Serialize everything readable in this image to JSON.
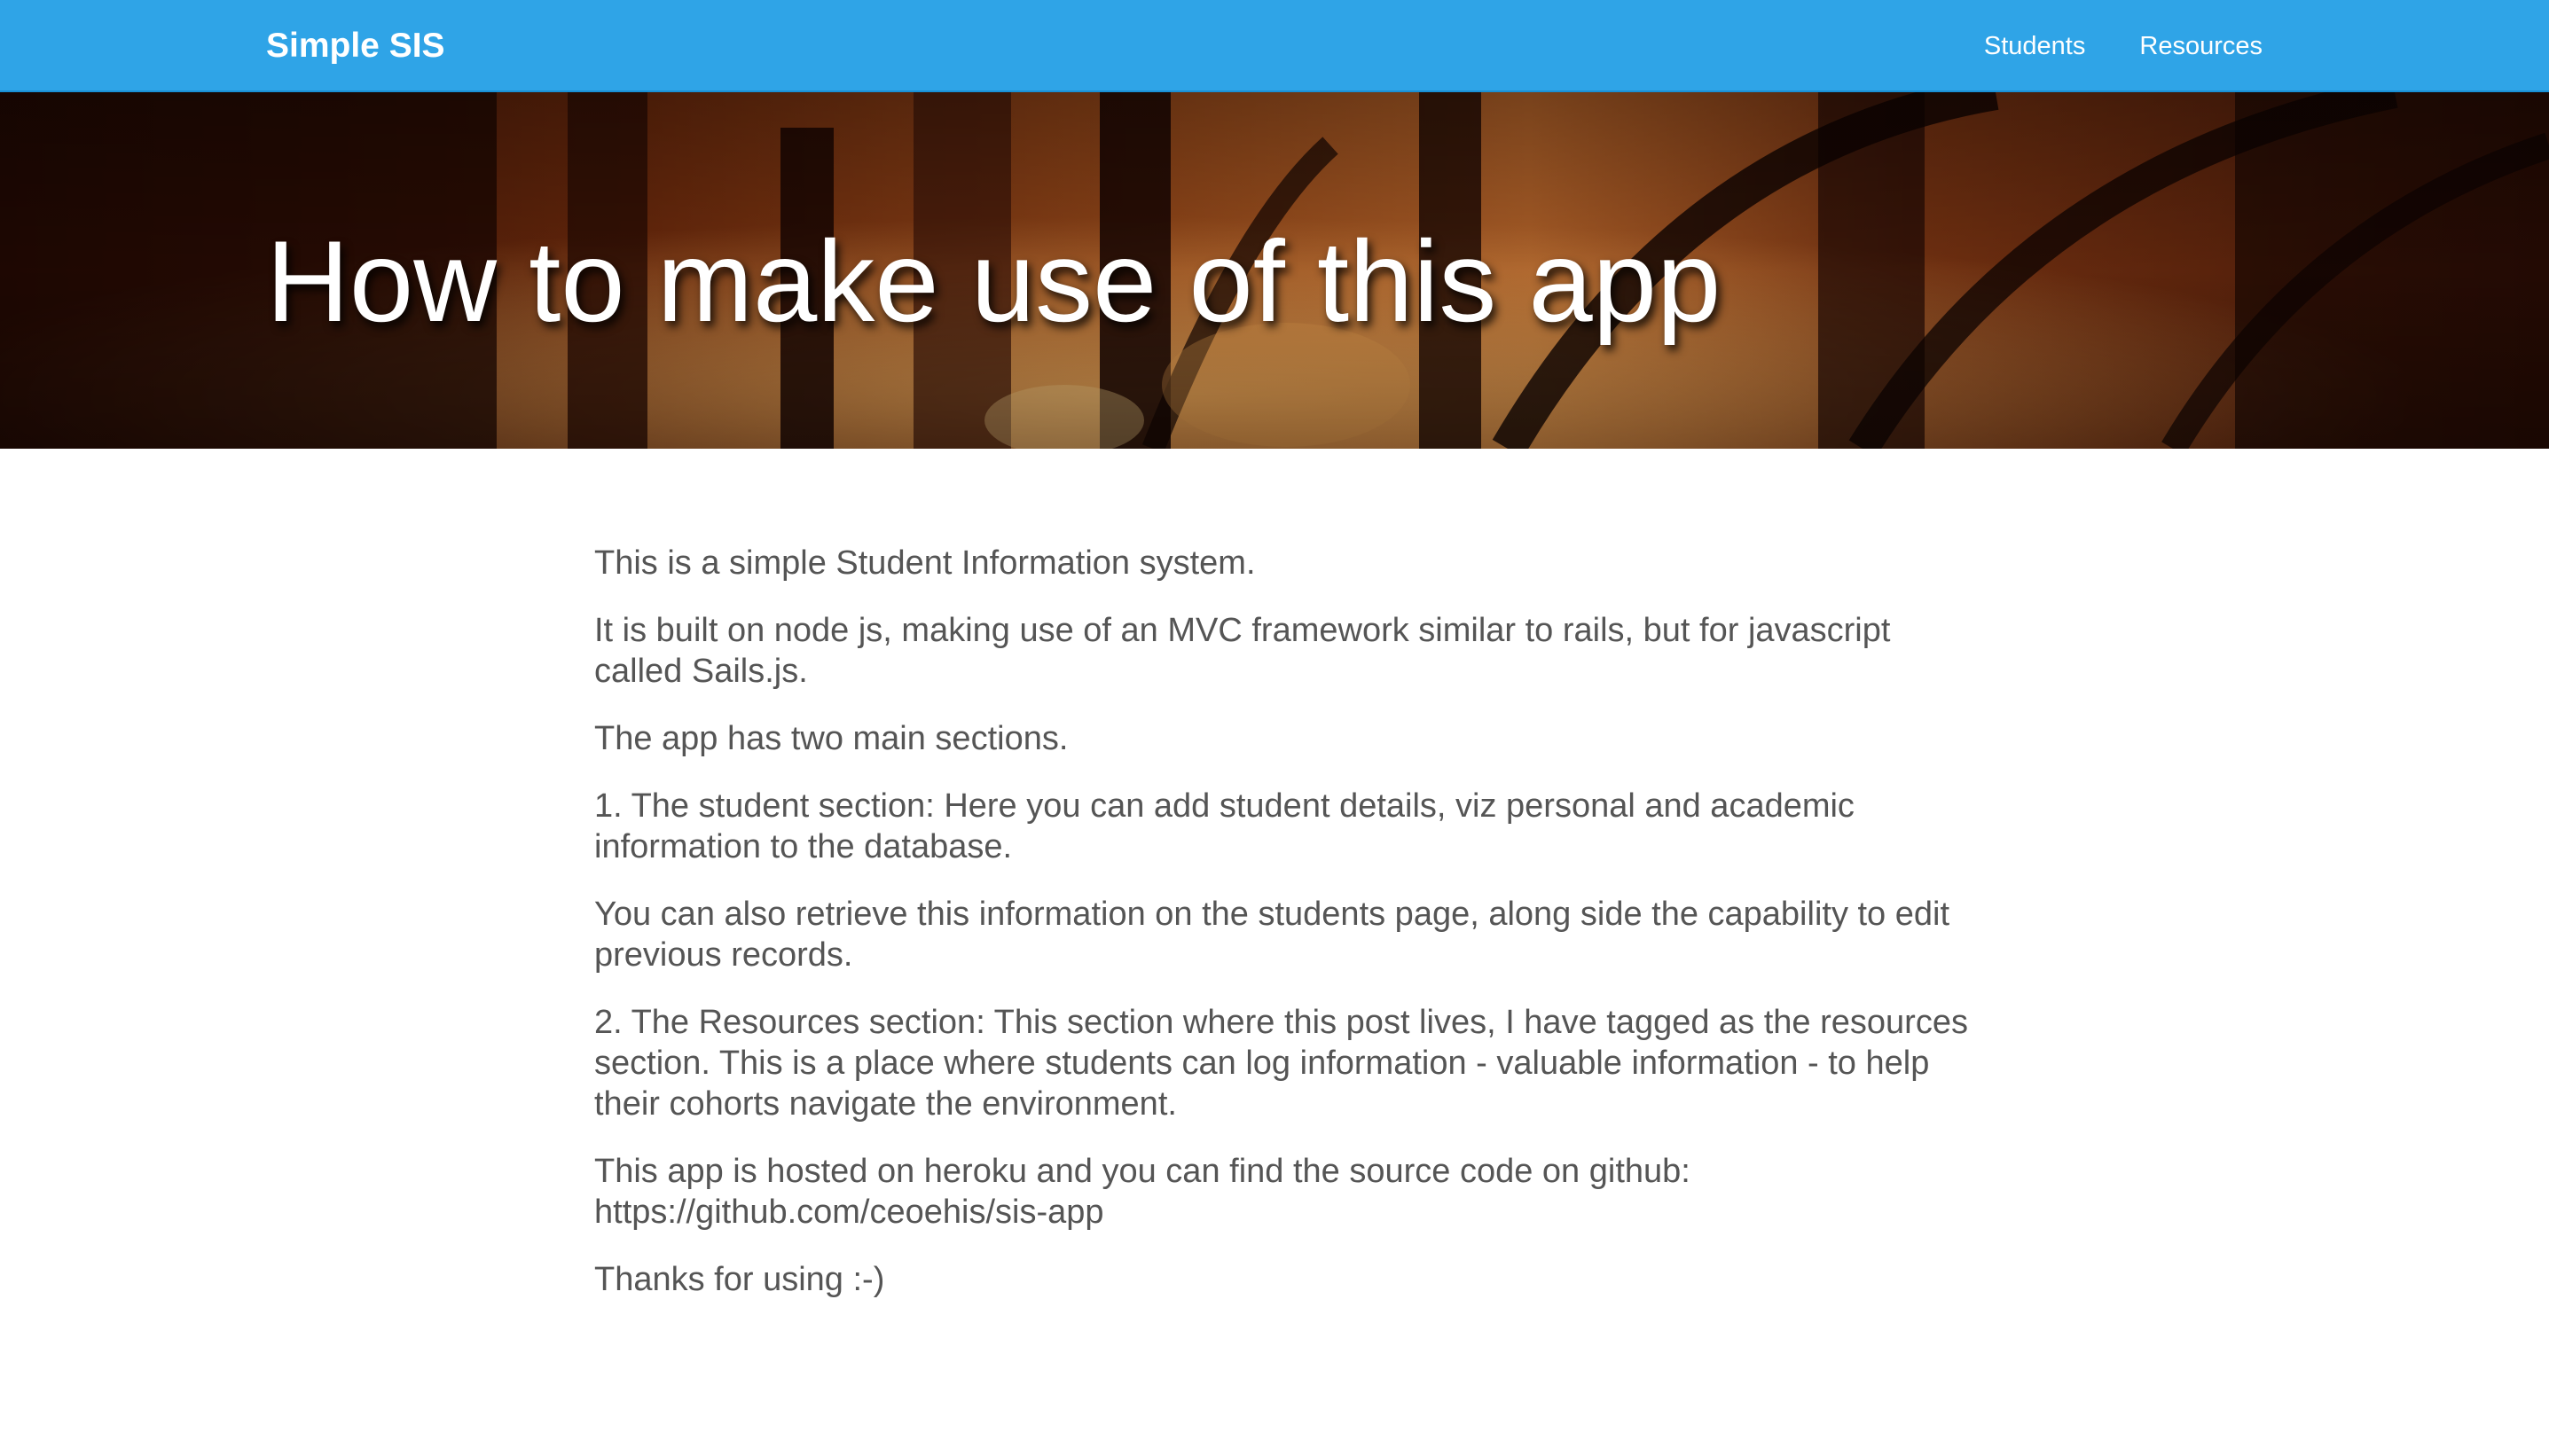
{
  "navbar": {
    "brand": "Simple SIS",
    "links": [
      "Students",
      "Resources"
    ]
  },
  "hero": {
    "title": "How to make use of this app"
  },
  "content": {
    "paragraphs": [
      "This is a simple Student Information system.",
      "It is built on node js, making use of an MVC framework similar to rails, but for javascript called Sails.js.",
      "The app has two main sections.",
      "1. The student section: Here you can add student details, viz personal and academic information to the database.",
      "You can also retrieve this information on the students page, along side the capability to edit previous records.",
      "2. The Resources section: This section where this post lives, I have tagged as the resources section. This is a place where students can log information - valuable information - to help their cohorts navigate the environment.",
      "This app is hosted on heroku and you can find the source code on github: https://github.com/ceoehis/sis-app",
      "Thanks for using :-)"
    ]
  },
  "colors": {
    "navbar_bg": "#2fa4e7",
    "body_text": "#555555",
    "hero_text": "#ffffff"
  }
}
